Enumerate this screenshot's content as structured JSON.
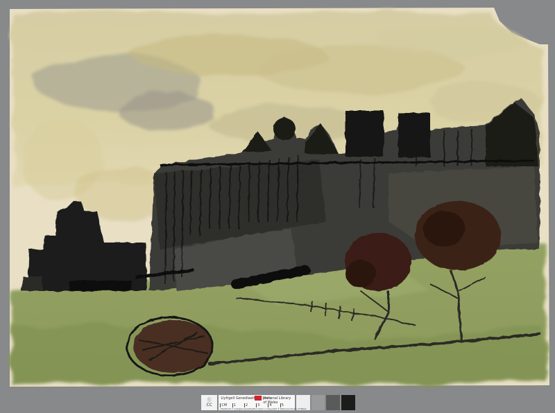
{
  "image": {
    "subject": "castle-on-hill-watercolour-sketch",
    "palette": {
      "paper": "#e6dcc0",
      "sky_wash": "#cfc596",
      "sky_grey": "#9b9b8f",
      "ink": "#1b1b19",
      "wall_grey": "#3a3a36",
      "grass": "#8a9a5a",
      "grass_dark": "#6e7c46",
      "tree_brown": "#3a1f15",
      "background": "#87898a"
    }
  },
  "scale_bar": {
    "logo_lines": [
      "ⓒ",
      "CC"
    ],
    "institution_cy": "Llyfrgell Genedlaethol Cymru",
    "institution_en": "National Library of Wales",
    "ruler_label": "CM",
    "ruler_ticks": [
      "0",
      "1",
      "2",
      "3",
      "4",
      "5"
    ],
    "rights_text": "Hawlfraint © Llyfrgell Genedlaethol Cymru / Copyright © National Library of Wales",
    "swatches": [
      "#eeeeee",
      "#9a9a9a",
      "#5a5a5a",
      "#1c1c1c"
    ]
  }
}
